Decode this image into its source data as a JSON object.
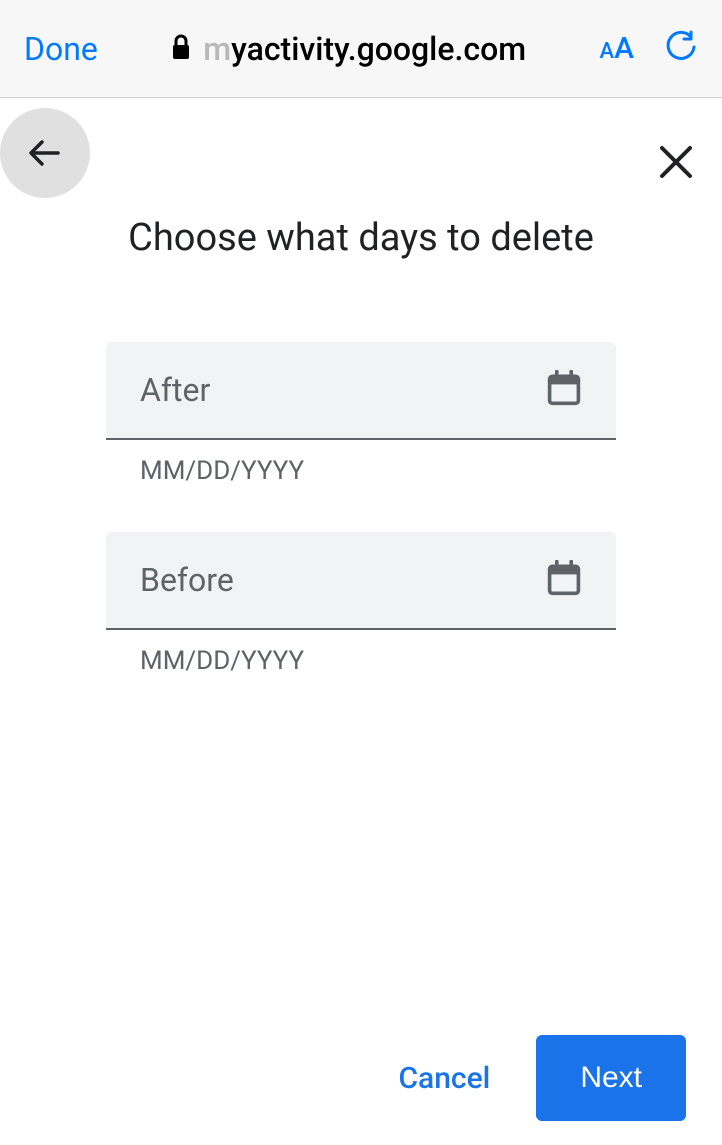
{
  "browser": {
    "done_label": "Done",
    "url_faded": "m",
    "url_rest": "yactivity.google.com",
    "text_size_label": "aA"
  },
  "page": {
    "title": "Choose what days to delete"
  },
  "form": {
    "after": {
      "label": "After",
      "helper": "MM/DD/YYYY"
    },
    "before": {
      "label": "Before",
      "helper": "MM/DD/YYYY"
    }
  },
  "buttons": {
    "cancel": "Cancel",
    "next": "Next"
  }
}
